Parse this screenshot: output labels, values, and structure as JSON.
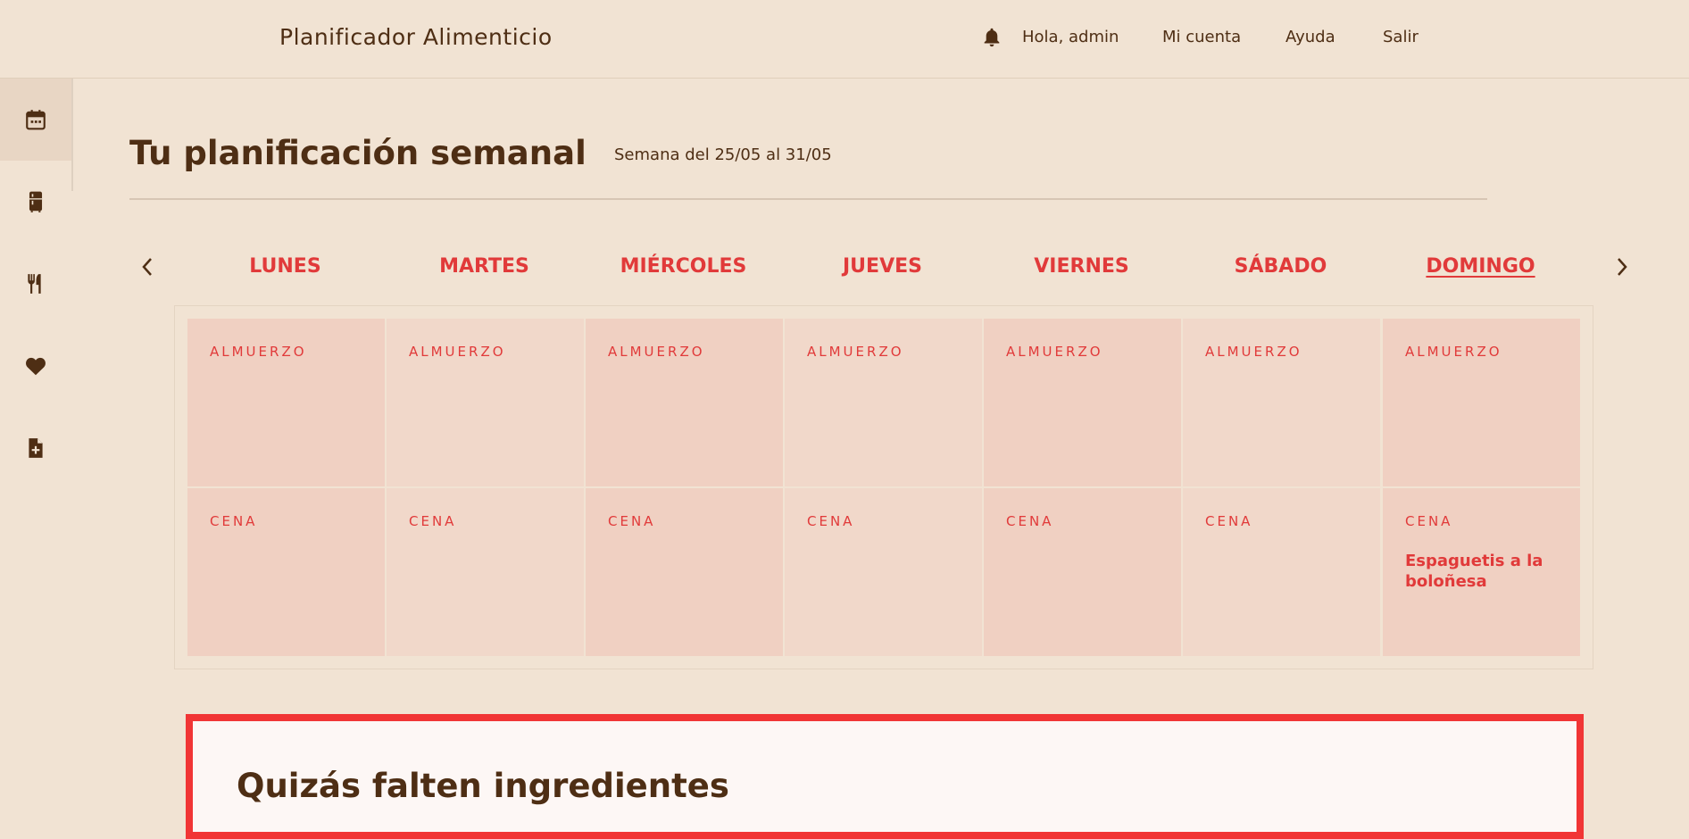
{
  "header": {
    "app_title": "Planificador Alimenticio",
    "greeting": "Hola, admin",
    "nav": [
      "Mi cuenta",
      "Ayuda",
      "Salir"
    ]
  },
  "sidebar": {
    "items": [
      {
        "icon": "calendar-icon",
        "active": true
      },
      {
        "icon": "fridge-icon",
        "active": false
      },
      {
        "icon": "utensils-icon",
        "active": false
      },
      {
        "icon": "heart-icon",
        "active": false
      },
      {
        "icon": "file-plus-icon",
        "active": false
      }
    ]
  },
  "main": {
    "title": "Tu planificación semanal",
    "week_range": "Semana del 25/05 al 31/05",
    "days": [
      "LUNES",
      "MARTES",
      "MIÉRCOLES",
      "JUEVES",
      "VIERNES",
      "SÁBADO",
      "DOMINGO"
    ],
    "current_day": "DOMINGO",
    "meals": {
      "lunch_label": "ALMUERZO",
      "dinner_label": "CENA"
    },
    "domingo_dinner": "Espaguetis a la boloñesa",
    "alert_title": "Quizás falten ingredientes"
  },
  "colors": {
    "background": "#f1e3d3",
    "text": "#4e2e14",
    "accent": "#e13a3a",
    "cell": "#f0d0c2",
    "alert_border": "#f13535"
  }
}
